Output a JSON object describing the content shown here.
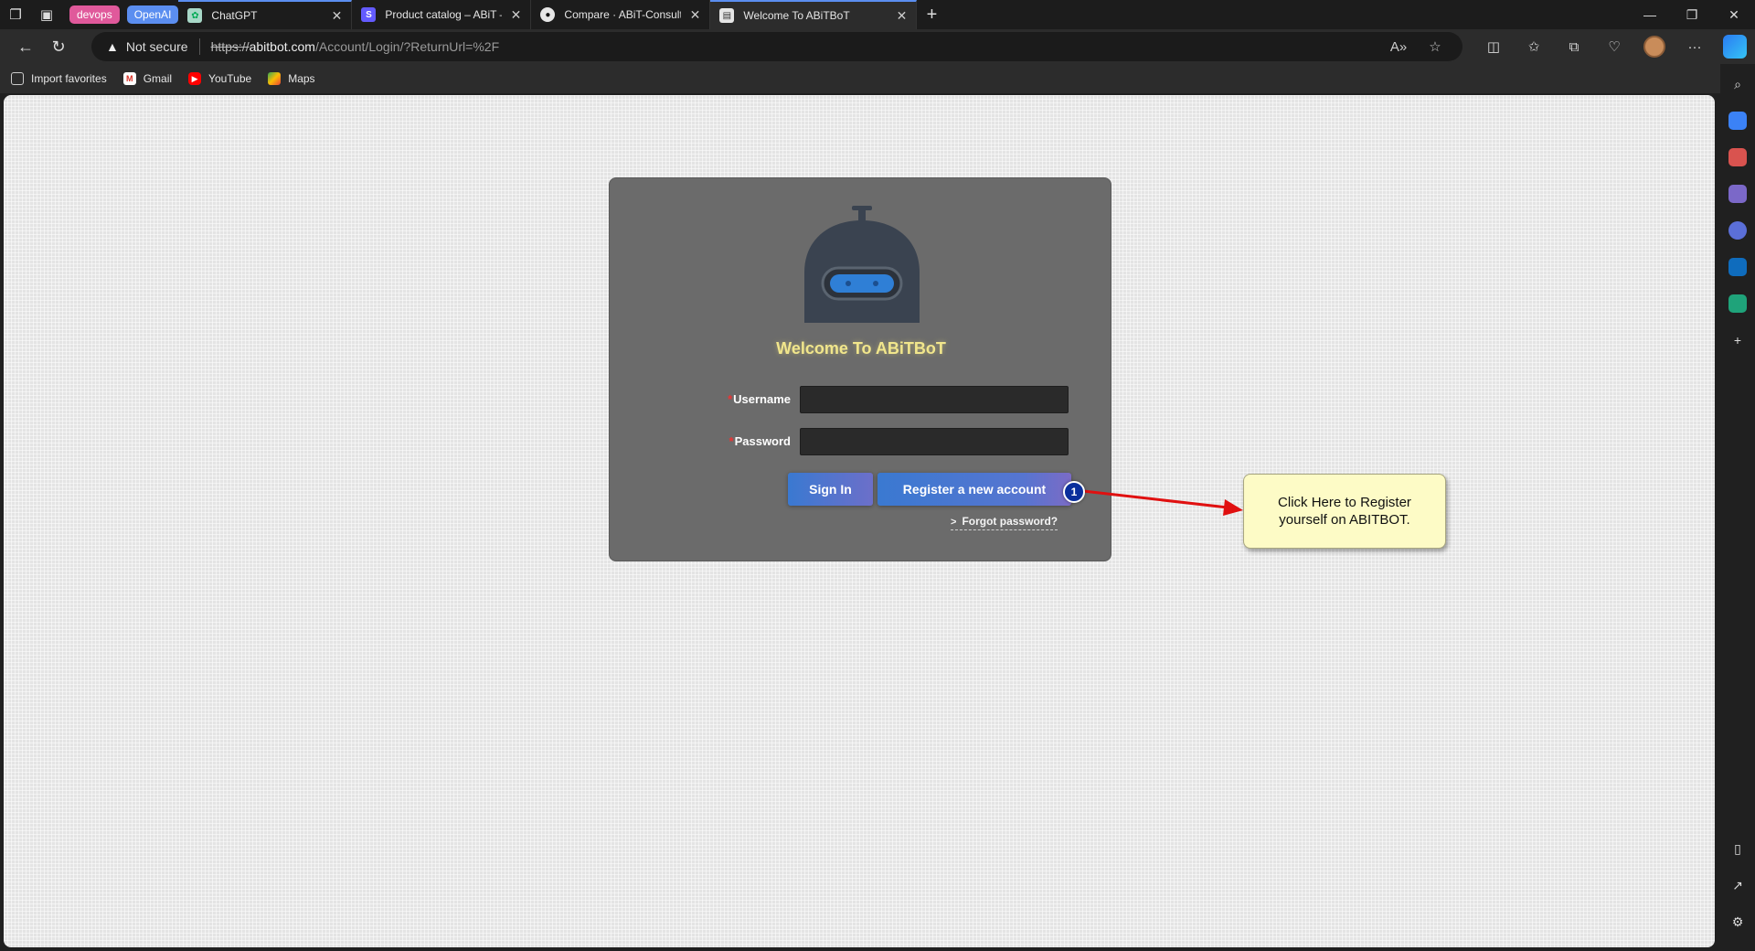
{
  "tabstrip": {
    "groups": [
      {
        "label": "devops",
        "color": "#e0599b"
      },
      {
        "label": "OpenAI",
        "color": "#5b8ef0"
      }
    ],
    "tabs": [
      {
        "title": "ChatGPT",
        "favicon": "chatgpt-icon"
      },
      {
        "title": "Product catalog – ABiT – Stripe [",
        "favicon": "stripe-icon"
      },
      {
        "title": "Compare · ABiT-Consulting/ABiT",
        "favicon": "github-icon"
      },
      {
        "title": "Welcome To ABiTBoT",
        "favicon": "page-icon",
        "active": true
      }
    ]
  },
  "toolbar": {
    "security_label": "Not secure",
    "url_scheme": "https://",
    "url_host": "abitbot.com",
    "url_path": "/Account/Login/?ReturnUrl=%2F"
  },
  "favorites": [
    {
      "label": "Import favorites",
      "icon": "import-icon"
    },
    {
      "label": "Gmail",
      "icon": "gmail-icon"
    },
    {
      "label": "YouTube",
      "icon": "youtube-icon"
    },
    {
      "label": "Maps",
      "icon": "maps-icon"
    }
  ],
  "login": {
    "title": "Welcome To ABiTBoT",
    "username_label": "Username",
    "password_label": "Password",
    "required_mark": "*",
    "signin_label": "Sign In",
    "register_label": "Register a new account",
    "forgot_label": "Forgot password?"
  },
  "annotation": {
    "step": "1",
    "callout": "Click Here to Register yourself on ABITBOT."
  },
  "colors": {
    "accent": "#5b8ef0",
    "welcome_text": "#f1e68c",
    "card_bg": "#6b6b6b",
    "arrow": "#e01010",
    "callout_bg": "#fdfbc6"
  }
}
